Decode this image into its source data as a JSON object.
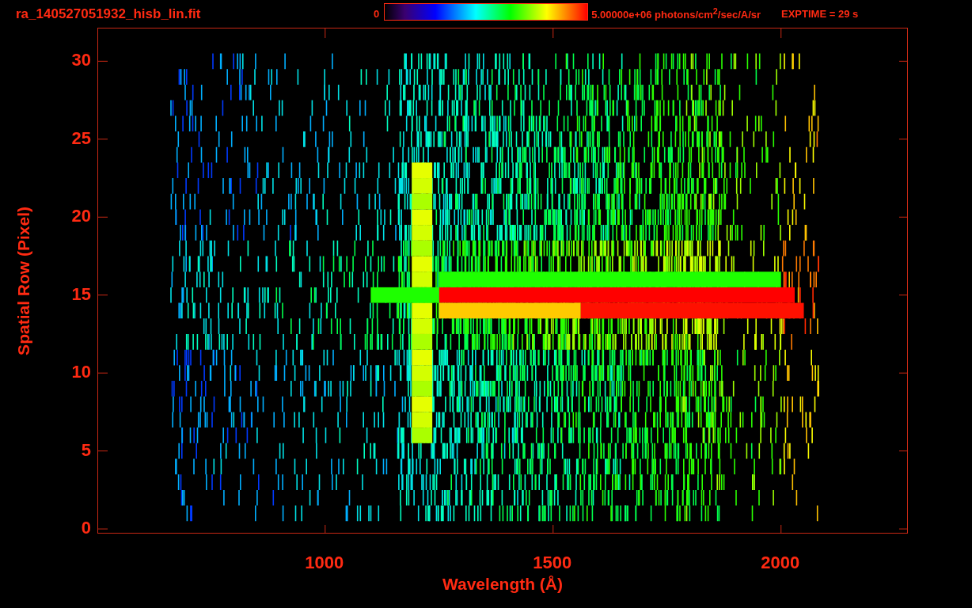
{
  "title": "ra_140527051932_hisb_lin.fit",
  "colorbar": {
    "min_label": "0",
    "max_label": "5.00000e+06 photons/cm$^{2}$/sec/A/sr"
  },
  "exposure": "EXPTIME = 29 s",
  "plot": {
    "xlabel": "Wavelength (Å)",
    "ylabel": "Spatial Row (Pixel)",
    "yticks": [
      "30",
      "25",
      "20",
      "15",
      "10",
      "5",
      "0"
    ],
    "xticks": [
      "1000",
      "1500",
      "2000"
    ]
  }
}
